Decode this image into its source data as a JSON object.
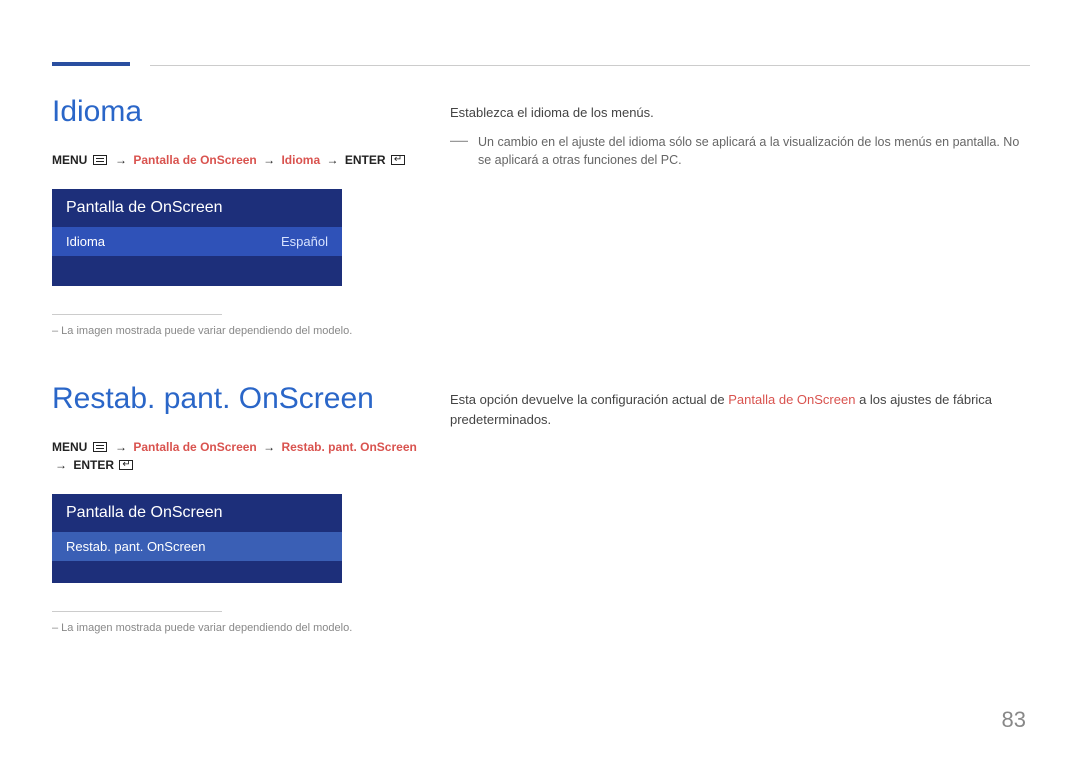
{
  "page_number": "83",
  "section1": {
    "heading": "Idioma",
    "breadcrumb": {
      "menu": "MENU",
      "p1": "Pantalla de OnScreen",
      "p2": "Idioma",
      "enter": "ENTER"
    },
    "osd": {
      "title": "Pantalla de OnScreen",
      "row_label": "Idioma",
      "row_value": "Español"
    },
    "caption": "– La imagen mostrada puede variar dependiendo del modelo.",
    "desc": "Establezca el idioma de los menús.",
    "note": "Un cambio en el ajuste del idioma sólo se aplicará a la visualización de los menús en pantalla. No se aplicará a otras funciones del PC."
  },
  "section2": {
    "heading": "Restab. pant. OnScreen",
    "breadcrumb": {
      "menu": "MENU",
      "p1": "Pantalla de OnScreen",
      "p2": "Restab. pant. OnScreen",
      "enter": "ENTER"
    },
    "osd": {
      "title": "Pantalla de OnScreen",
      "row_label": "Restab. pant. OnScreen"
    },
    "caption": "– La imagen mostrada puede variar dependiendo del modelo.",
    "desc_pre": "Esta opción devuelve la configuración actual de ",
    "desc_hl": "Pantalla de OnScreen",
    "desc_post": " a los ajustes de fábrica predeterminados."
  }
}
